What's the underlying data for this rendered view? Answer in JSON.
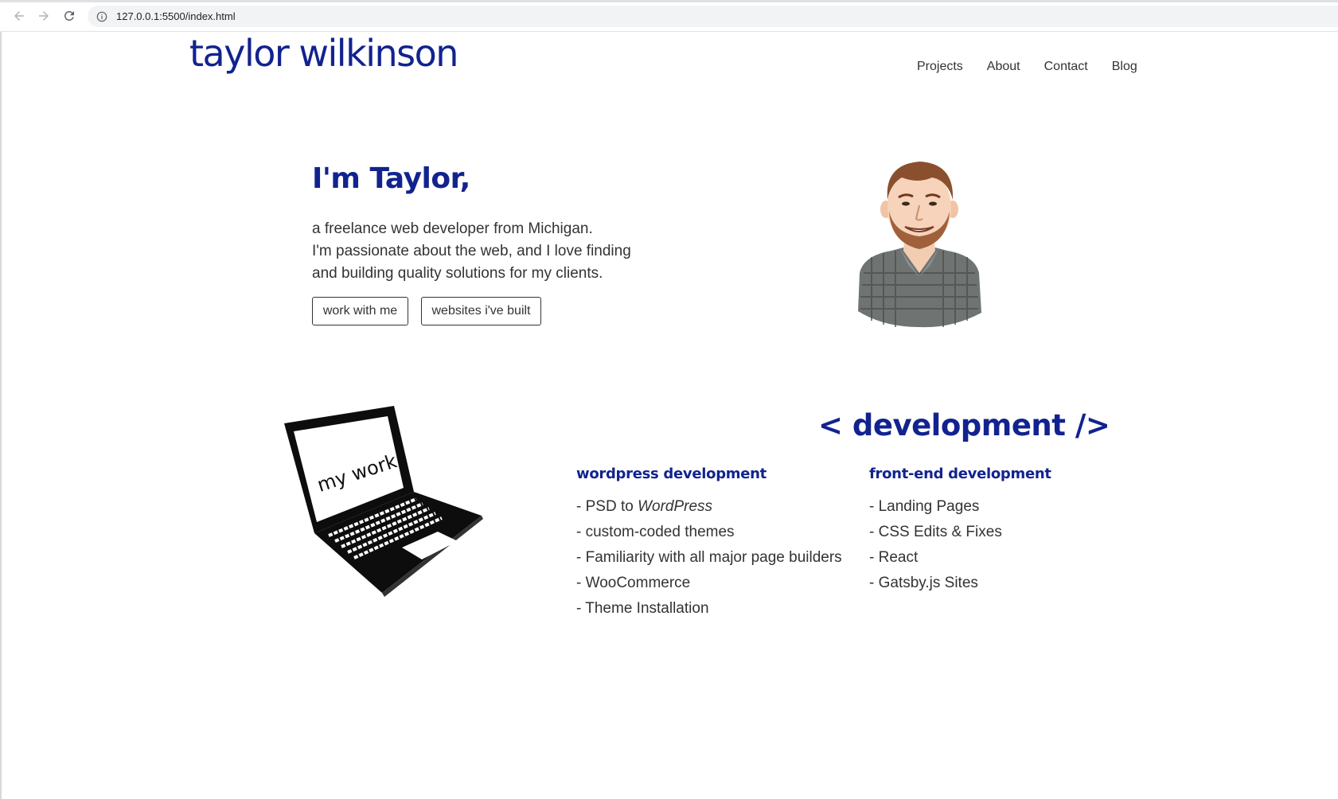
{
  "browser": {
    "url": "127.0.0.1:5500/index.html"
  },
  "site": {
    "name": "taylor wilkinson"
  },
  "nav": {
    "items": [
      {
        "label": "Projects"
      },
      {
        "label": "About"
      },
      {
        "label": "Contact"
      },
      {
        "label": "Blog"
      }
    ]
  },
  "hero": {
    "title": "I'm Taylor,",
    "lines": [
      "a freelance web developer from Michigan.",
      "I'm passionate about the web, and I love finding",
      "and building quality solutions for my clients."
    ],
    "btn_work": "work with me",
    "btn_sites": "websites i've built"
  },
  "laptop": {
    "screen_text": "my work"
  },
  "development": {
    "title": "< development />",
    "wordpress": {
      "heading": "wordpress development",
      "items": [
        {
          "prefix": "- PSD to ",
          "emph": "WordPress"
        },
        {
          "prefix": "- custom-coded themes",
          "emph": ""
        },
        {
          "prefix": "- Familiarity with all major page builders",
          "emph": ""
        },
        {
          "prefix": "- WooCommerce",
          "emph": ""
        },
        {
          "prefix": "- Theme Installation",
          "emph": ""
        }
      ]
    },
    "frontend": {
      "heading": "front-end development",
      "items": [
        {
          "prefix": "- Landing Pages",
          "emph": ""
        },
        {
          "prefix": "- CSS Edits & Fixes",
          "emph": ""
        },
        {
          "prefix": "- React",
          "emph": ""
        },
        {
          "prefix": "- Gatsby.js Sites",
          "emph": ""
        }
      ]
    }
  }
}
